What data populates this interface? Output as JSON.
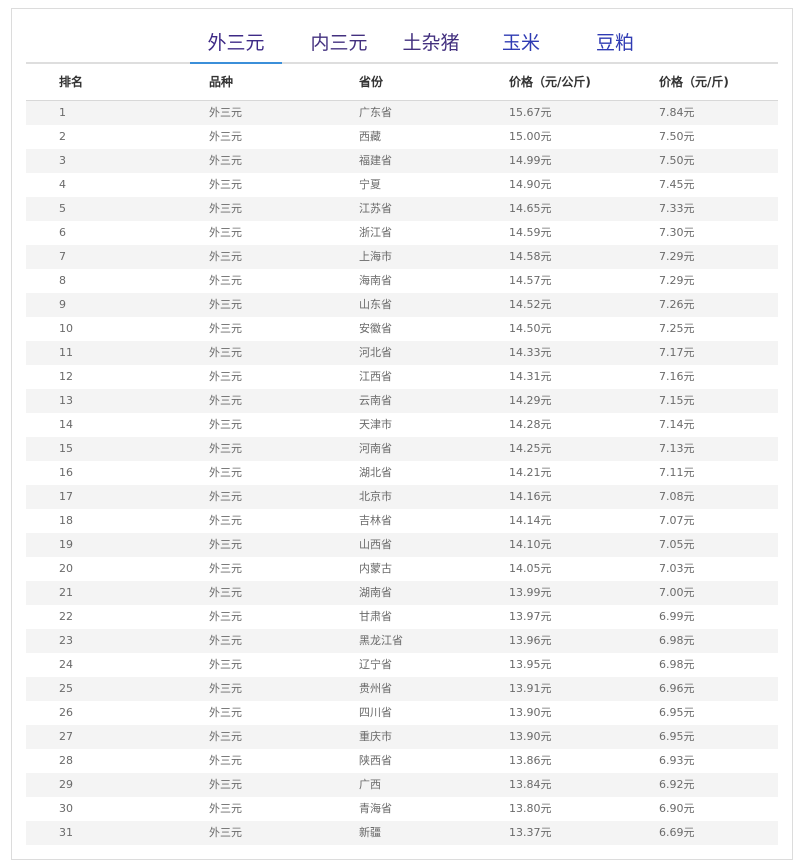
{
  "tabs": [
    "外三元",
    "内三元",
    "土杂猪",
    "玉米",
    "豆粕"
  ],
  "active_tab": 0,
  "table": {
    "headers": [
      "排名",
      "品种",
      "省份",
      "价格（元/公斤)",
      "价格（元/斤)"
    ],
    "rows": [
      [
        "1",
        "外三元",
        "广东省",
        "15.67元",
        "7.84元"
      ],
      [
        "2",
        "外三元",
        "西藏",
        "15.00元",
        "7.50元"
      ],
      [
        "3",
        "外三元",
        "福建省",
        "14.99元",
        "7.50元"
      ],
      [
        "4",
        "外三元",
        "宁夏",
        "14.90元",
        "7.45元"
      ],
      [
        "5",
        "外三元",
        "江苏省",
        "14.65元",
        "7.33元"
      ],
      [
        "6",
        "外三元",
        "浙江省",
        "14.59元",
        "7.30元"
      ],
      [
        "7",
        "外三元",
        "上海市",
        "14.58元",
        "7.29元"
      ],
      [
        "8",
        "外三元",
        "海南省",
        "14.57元",
        "7.29元"
      ],
      [
        "9",
        "外三元",
        "山东省",
        "14.52元",
        "7.26元"
      ],
      [
        "10",
        "外三元",
        "安徽省",
        "14.50元",
        "7.25元"
      ],
      [
        "11",
        "外三元",
        "河北省",
        "14.33元",
        "7.17元"
      ],
      [
        "12",
        "外三元",
        "江西省",
        "14.31元",
        "7.16元"
      ],
      [
        "13",
        "外三元",
        "云南省",
        "14.29元",
        "7.15元"
      ],
      [
        "14",
        "外三元",
        "天津市",
        "14.28元",
        "7.14元"
      ],
      [
        "15",
        "外三元",
        "河南省",
        "14.25元",
        "7.13元"
      ],
      [
        "16",
        "外三元",
        "湖北省",
        "14.21元",
        "7.11元"
      ],
      [
        "17",
        "外三元",
        "北京市",
        "14.16元",
        "7.08元"
      ],
      [
        "18",
        "外三元",
        "吉林省",
        "14.14元",
        "7.07元"
      ],
      [
        "19",
        "外三元",
        "山西省",
        "14.10元",
        "7.05元"
      ],
      [
        "20",
        "外三元",
        "内蒙古",
        "14.05元",
        "7.03元"
      ],
      [
        "21",
        "外三元",
        "湖南省",
        "13.99元",
        "7.00元"
      ],
      [
        "22",
        "外三元",
        "甘肃省",
        "13.97元",
        "6.99元"
      ],
      [
        "23",
        "外三元",
        "黑龙江省",
        "13.96元",
        "6.98元"
      ],
      [
        "24",
        "外三元",
        "辽宁省",
        "13.95元",
        "6.98元"
      ],
      [
        "25",
        "外三元",
        "贵州省",
        "13.91元",
        "6.96元"
      ],
      [
        "26",
        "外三元",
        "四川省",
        "13.90元",
        "6.95元"
      ],
      [
        "27",
        "外三元",
        "重庆市",
        "13.90元",
        "6.95元"
      ],
      [
        "28",
        "外三元",
        "陕西省",
        "13.86元",
        "6.93元"
      ],
      [
        "29",
        "外三元",
        "广西",
        "13.84元",
        "6.92元"
      ],
      [
        "30",
        "外三元",
        "青海省",
        "13.80元",
        "6.90元"
      ],
      [
        "31",
        "外三元",
        "新疆",
        "13.37元",
        "6.69元"
      ]
    ]
  }
}
